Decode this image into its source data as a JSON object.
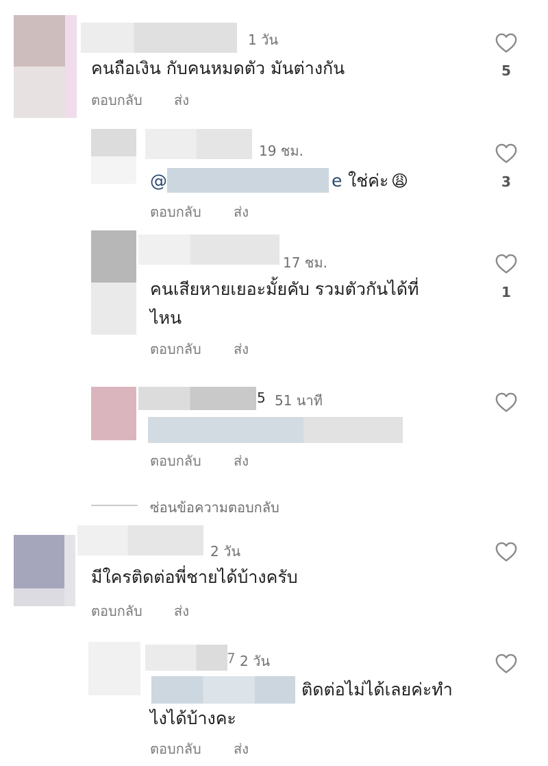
{
  "actions": {
    "reply": "ตอบกลับ",
    "send": "ส่ง"
  },
  "hide_replies": "ซ่อนข้อความตอบกลับ",
  "comments": [
    {
      "time": "1 วัน",
      "text": "คนถือเงิน กับคนหมดตัว มันต่างกัน",
      "likes": "5"
    },
    {
      "time": "19 ชม.",
      "mention_prefix": "@",
      "mention_suffix": "e",
      "text": "ใช่ค่ะ",
      "emoji": "😩",
      "likes": "3"
    },
    {
      "time": "17 ชม.",
      "text_line1": "คนเสียหายเยอะมั้ยคับ รวมตัวกันได้ที่",
      "text_line2": "ไหน",
      "likes": "1"
    },
    {
      "username_tail": "5",
      "time": "51 นาที"
    },
    {
      "time": "2 วัน",
      "text": "มีใครติดต่อพี่ชายได้บ้างครับ"
    },
    {
      "username_tail": "7",
      "time": "2 วัน",
      "text_line1": "ติดต่อไม่ได้เลยค่ะทำ",
      "text_line2": "ไงได้บ้างคะ"
    }
  ],
  "icons": {
    "like": "heart-outline-icon"
  },
  "colors": {
    "meta_text": "#6f6f6f",
    "mention": "#2b4a6e",
    "heart_stroke": "#8a8a8a"
  }
}
